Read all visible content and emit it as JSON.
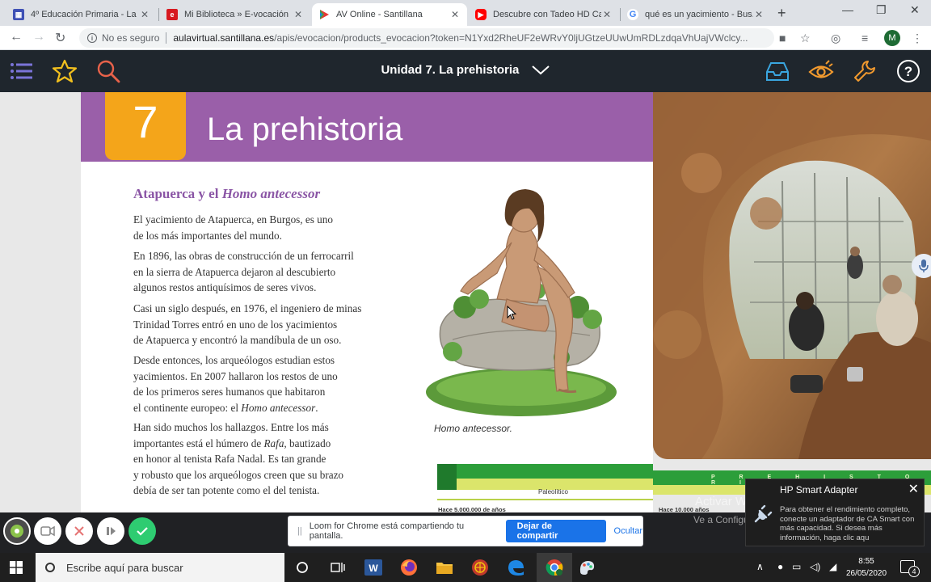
{
  "browser": {
    "tabs": [
      {
        "title": "4º Educación Primaria - La ...",
        "favicon": "blue-grid",
        "active": false
      },
      {
        "title": "Mi Biblioteca » E-vocación",
        "favicon": "red-e",
        "active": false
      },
      {
        "title": "AV Online - Santillana",
        "favicon": "santillana",
        "active": true
      },
      {
        "title": "Descubre con Tadeo HD Ca...",
        "favicon": "youtube",
        "active": false
      },
      {
        "title": "qué es un yacimiento - Bus...",
        "favicon": "google",
        "active": false
      }
    ],
    "address": {
      "security_label": "No es seguro",
      "domain": "aulavirtual.santillana.es",
      "path": "/apis/evocacion/products_evocacion?token=N1Yxd2RheUF2eWRvY0ljUGtzeUUwUmRDLzdqaVhUajVWclcy..."
    },
    "profile_initial": "M"
  },
  "app_header": {
    "unit_title": "Unidad 7. La prehistoria"
  },
  "page": {
    "chapter_number": "7",
    "chapter_title": "La prehistoria",
    "section_title_a": "Atapuerca y el ",
    "section_title_b": "Homo antecessor",
    "paragraphs": [
      [
        "El yacimiento de Atapuerca, en Burgos, es uno",
        "de los más importantes del mundo."
      ],
      [
        "En 1896, las obras de construcción de un ferrocarril",
        "en la sierra de Atapuerca dejaron al descubierto",
        "algunos restos antiquísimos de seres vivos."
      ],
      [
        "Casi un siglo después, en 1976, el ingeniero de minas",
        "Trinidad Torres entró en uno de los yacimientos",
        "de Atapuerca y encontró la mandíbula de un oso."
      ]
    ],
    "p4": {
      "l1": "Desde entonces, los arqueólogos estudian estos",
      "l2": "yacimientos. En 2007 hallaron los restos de uno",
      "l3": "de los primeros seres humanos que habitaron",
      "l4a": "el continente europeo: el ",
      "l4b": "Homo antecessor",
      "l4c": "."
    },
    "p5": {
      "l1": "Han sido muchos los hallazgos. Entre los más",
      "l2a": "importantes está el húmero de ",
      "l2b": "Rafa",
      "l2c": ", bautizado",
      "l3": "en honor al tenista Rafa Nadal. Es tan grande",
      "l4": "y robusto que los arqueólogos creen que su brazo",
      "l5": "debía de ser tan potente como el del tenista."
    },
    "figure_caption": "Homo antecessor.",
    "timeline": {
      "era_label": "Paleolítico",
      "left_date": "Hace 5.000.000 de años",
      "right_date": "Hace 10.000 años",
      "band_letters": "P R E H I S T O R I A"
    }
  },
  "watermark": {
    "line1": "Activar Windows",
    "line2": "Ve a Configuración para activar Windows."
  },
  "toast": {
    "title": "HP Smart Adapter",
    "body": "Para obtener el rendimiento completo, conecte un adaptador de CA Smart con más capacidad. Si desea más información, haga clic aqu"
  },
  "loom": {
    "message": "Loom for Chrome está compartiendo tu pantalla.",
    "share_button": "Dejar de compartir",
    "hide_link": "Ocultar"
  },
  "taskbar": {
    "search_placeholder": "Escribe aquí para buscar",
    "time": "8:55",
    "date": "26/05/2020",
    "notification_count": "4"
  },
  "colors": {
    "banner_purple": "#9a5fa9",
    "chapter_orange": "#f4a51a",
    "header_dark": "#1f262d",
    "icon_blue": "#3aa6e0",
    "icon_orange": "#f29a2e",
    "icon_yellow": "#f2c01e",
    "loom_blue": "#1a73e8"
  }
}
